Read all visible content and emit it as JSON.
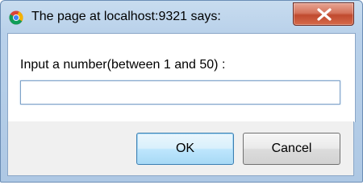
{
  "dialog": {
    "title": "The page at localhost:9321 says:",
    "prompt": "Input a number(between 1 and 50) :",
    "input_value": "",
    "ok_label": "OK",
    "cancel_label": "Cancel"
  },
  "icons": {
    "app": "chrome-logo-icon",
    "close": "close-icon"
  },
  "colors": {
    "titlebar": "#b9d1ea",
    "close_button": "#c75a40",
    "ok_button_border": "#3c7fb1"
  }
}
